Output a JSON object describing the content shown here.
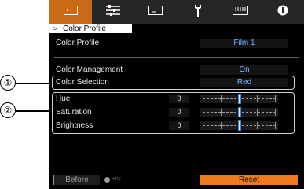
{
  "tabs": [
    {
      "icon": "picture-adjust-icon",
      "active": true
    },
    {
      "icon": "input-settings-icon",
      "active": false
    },
    {
      "icon": "display-setup-icon",
      "active": false
    },
    {
      "icon": "installation-wrench-icon",
      "active": false
    },
    {
      "icon": "function-icon",
      "active": false
    },
    {
      "icon": "information-icon",
      "active": false
    }
  ],
  "breadcrumb": {
    "arrow": ">",
    "title": "Color Profile"
  },
  "rows": {
    "color_profile": {
      "label": "Color Profile",
      "value": "Film 1"
    },
    "color_management": {
      "label": "Color Management",
      "value": "On"
    },
    "color_selection": {
      "label": "Color Selection",
      "value": "Red"
    }
  },
  "adjust": [
    {
      "label": "Hue",
      "value": "0",
      "level": 0.5
    },
    {
      "label": "Saturation",
      "value": "0",
      "level": 0.5
    },
    {
      "label": "Brightness",
      "value": "0",
      "level": 0.5
    }
  ],
  "bottom": {
    "before_label": "Before",
    "hide_label": "HIDE",
    "reset_label": "Reset"
  },
  "callouts": [
    "①",
    "②"
  ],
  "colors": {
    "accent": "#ee7a1c",
    "active_tab": "#c96a16",
    "value_text": "#6fb6ff"
  }
}
